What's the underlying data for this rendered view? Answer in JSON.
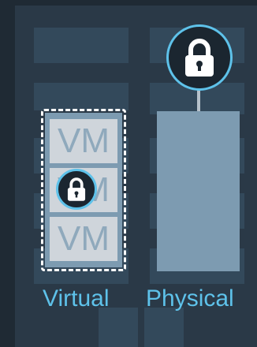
{
  "diagram": {
    "virtual_label": "Virtual",
    "physical_label": "Physical",
    "vm_boxes": [
      "VM",
      "VM",
      "VM"
    ],
    "icons": {
      "physical": "padlock-icon",
      "virtual": "padlock-icon"
    },
    "colors": {
      "background": "#2a3947",
      "accent": "#5ec2ea",
      "server_fill": "#7d9bb1",
      "vm_fill": "#cfd5db",
      "vm_text": "#8fa9bc",
      "dashed_border": "#ffffff"
    }
  }
}
